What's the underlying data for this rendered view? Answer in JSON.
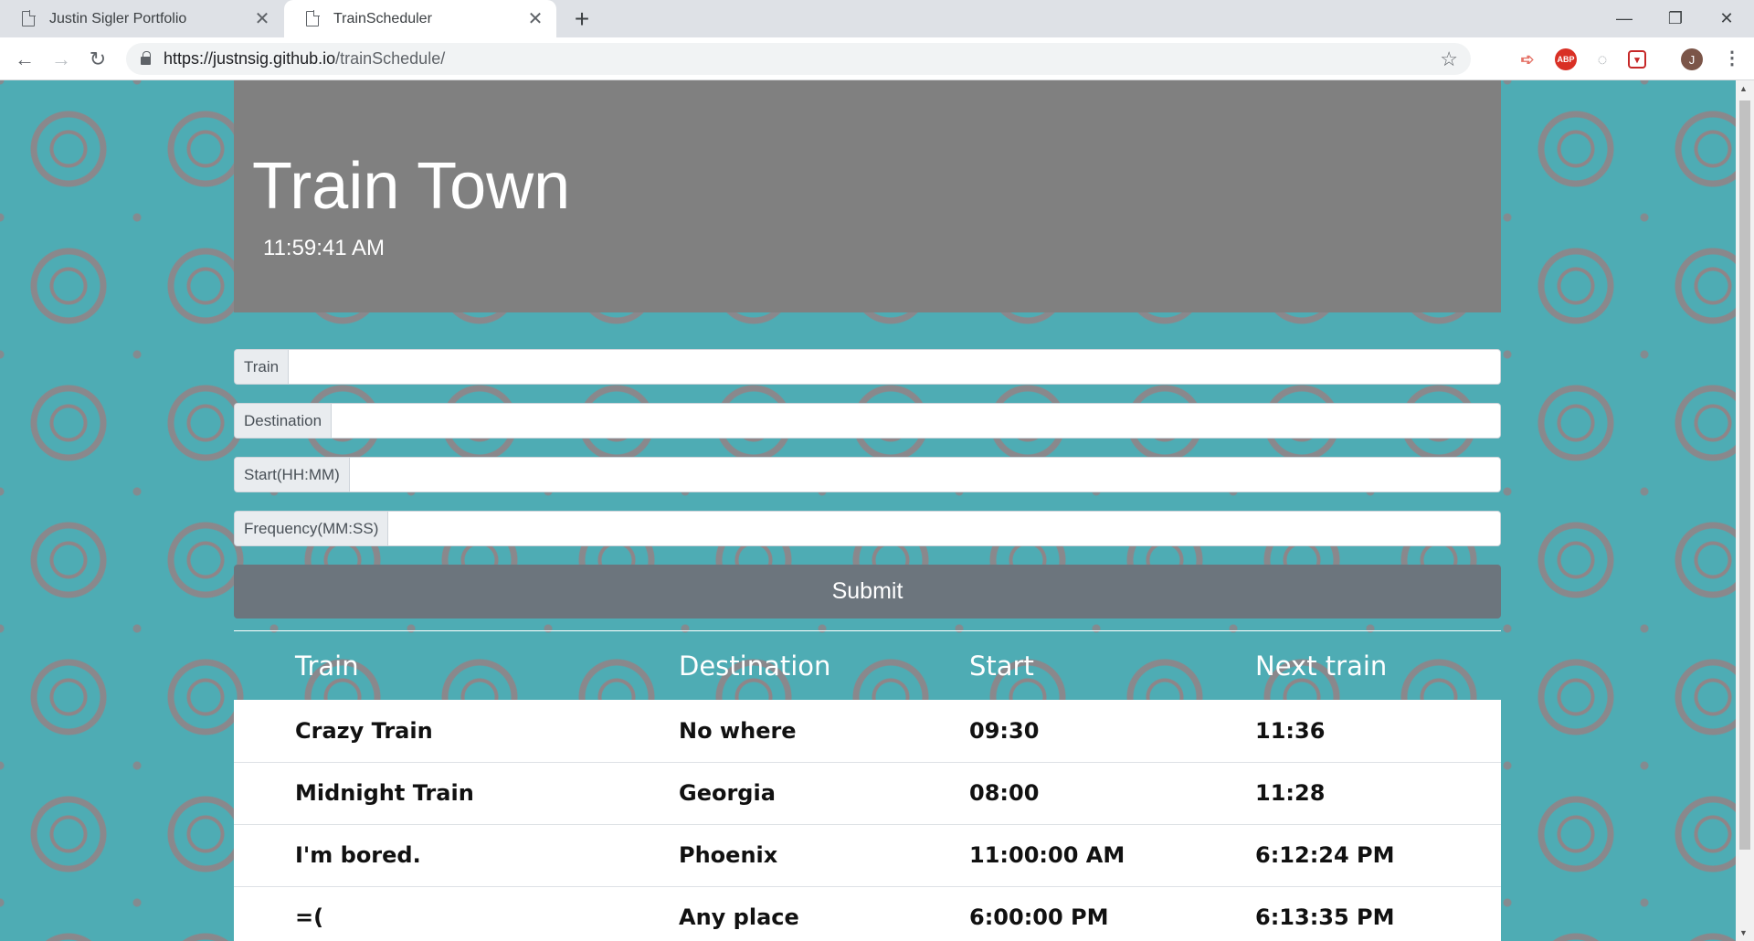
{
  "browser": {
    "tabs": [
      {
        "title": "Justin Sigler Portfolio",
        "active": false
      },
      {
        "title": "TrainScheduler",
        "active": true
      }
    ],
    "url_host": "https://justnsig.github.io",
    "url_path": "/trainSchedule/",
    "avatar_letter": "J",
    "extensions": [
      "arrow-extension-icon",
      "adblock-icon",
      "circle-extension-icon",
      "pocket-icon"
    ]
  },
  "page": {
    "title": "Train Town",
    "clock": "11:59:41 AM",
    "form": {
      "fields": [
        {
          "label": "Train",
          "value": ""
        },
        {
          "label": "Destination",
          "value": ""
        },
        {
          "label": "Start(HH:MM)",
          "value": ""
        },
        {
          "label": "Frequency(MM:SS)",
          "value": ""
        }
      ],
      "submit_label": "Submit"
    },
    "table": {
      "headers": [
        "Train",
        "Destination",
        "Start",
        "Next train"
      ],
      "rows": [
        [
          "Crazy Train",
          "No where",
          "09:30",
          "11:36"
        ],
        [
          "Midnight Train",
          "Georgia",
          "08:00",
          "11:28"
        ],
        [
          "I'm bored.",
          "Phoenix",
          "11:00:00 AM",
          "6:12:24 PM"
        ],
        [
          "=(",
          "Any place",
          "6:00:00 PM",
          "6:13:35 PM"
        ]
      ]
    }
  },
  "colors": {
    "background": "#4eacb4",
    "gear_pattern": "#c46464",
    "jumbotron": "#808080",
    "submit": "#6c757d"
  }
}
